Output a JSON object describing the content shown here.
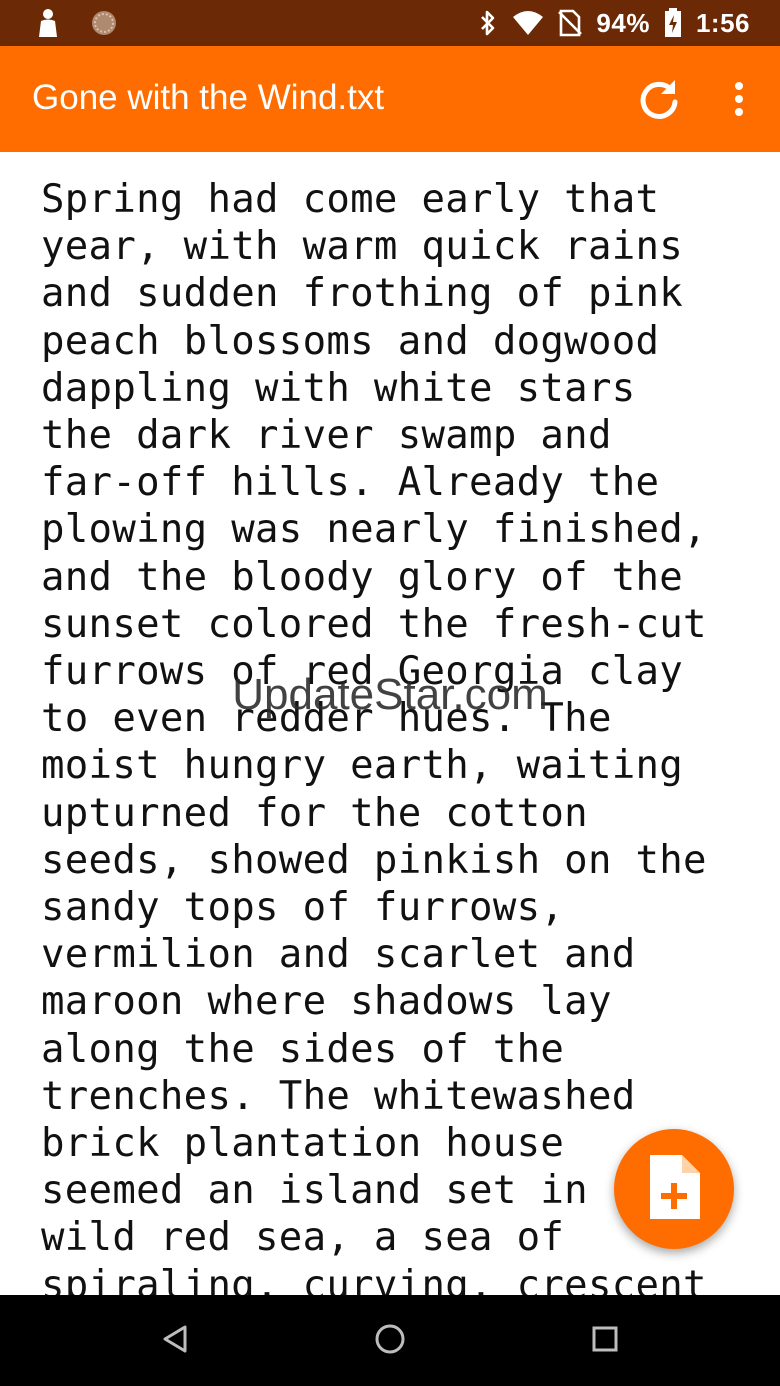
{
  "status_bar": {
    "battery": "94%",
    "time": "1:56",
    "left_icons": [
      "notification-icon",
      "sync-icon"
    ],
    "right_icons": [
      "bluetooth-icon",
      "wifi-icon",
      "no-sim-icon",
      "battery-icon"
    ]
  },
  "app_bar": {
    "title": "Gone with the Wind.txt",
    "actions": [
      "refresh-icon",
      "overflow-menu-icon"
    ]
  },
  "document": {
    "lines": [
      "Spring had come early that",
      "year, with warm quick rains",
      "and sudden frothing of pink",
      "peach blossoms and dogwood",
      "dappling with white stars",
      "the dark river swamp and",
      "far-off hills. Already the",
      "plowing was nearly finished,",
      "and the bloody glory of the",
      "sunset colored the fresh-cut",
      "furrows of red Georgia clay",
      "to even redder hues. The",
      "moist hungry earth, waiting",
      "upturned for the cotton",
      "seeds, showed pinkish on the",
      "sandy tops of furrows,",
      "vermilion and scarlet and",
      "maroon where shadows lay",
      "along the sides of the",
      "trenches. The whitewashed",
      "brick plantation house",
      "seemed an island set in",
      "wild red sea, a sea of",
      "spiraling, curving, crescent"
    ]
  },
  "watermark": "UpdateStar.com",
  "fab": {
    "icon": "new-file-icon"
  },
  "nav_bar": {
    "buttons": [
      "back-icon",
      "home-icon",
      "recents-icon"
    ]
  },
  "colors": {
    "status_bar": "#6b2a05",
    "app_bar": "#ff6d00",
    "fab": "#ff6d00",
    "text": "#111111",
    "nav_bar": "#000000"
  }
}
